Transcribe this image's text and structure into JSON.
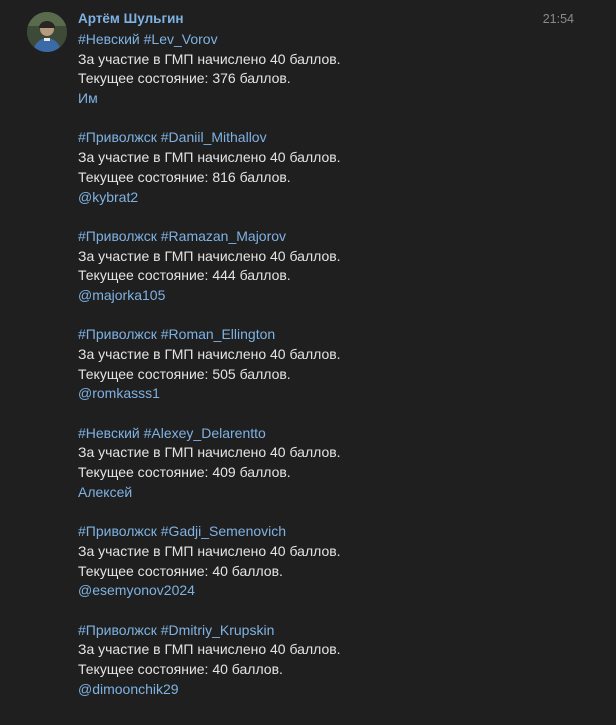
{
  "message": {
    "author": "Артём Шульгин",
    "time": "21:54",
    "blocks": [
      {
        "tags": "#Невский #Lev_Vorov",
        "line1": "За участие в ГМП начислено 40 баллов.",
        "line2": "Текущее состояние: 376 баллов.",
        "mention": "Им"
      },
      {
        "tags": "#Приволжск #Daniil_Mithallov",
        "line1": "За участие в ГМП начислено 40 баллов.",
        "line2": "Текущее состояние: 816 баллов.",
        "mention": "@kybrat2"
      },
      {
        "tags": "#Приволжск #Ramazan_Majorov",
        "line1": "За участие в ГМП начислено 40 баллов.",
        "line2": "Текущее состояние: 444 баллов.",
        "mention": "@majorka105"
      },
      {
        "tags": "#Приволжск #Roman_Ellington",
        "line1": "За участие в ГМП начислено 40 баллов.",
        "line2": "Текущее состояние: 505 баллов.",
        "mention": "@romkasss1"
      },
      {
        "tags": "#Невский #Alexey_Delarentto",
        "line1": "За участие в ГМП начислено 40 баллов.",
        "line2": "Текущее состояние: 409 баллов.",
        "mention": "Алексей"
      },
      {
        "tags": "#Приволжск #Gadji_Semenovich",
        "line1": "За участие в ГМП начислено 40 баллов.",
        "line2": "Текущее состояние: 40 баллов.",
        "mention": "@esemyonov2024"
      },
      {
        "tags": "#Приволжск #Dmitriy_Krupskin",
        "line1": "За участие в ГМП начислено 40 баллов.",
        "line2": "Текущее состояние: 40 баллов.",
        "mention": "@dimoonchik29"
      }
    ]
  }
}
